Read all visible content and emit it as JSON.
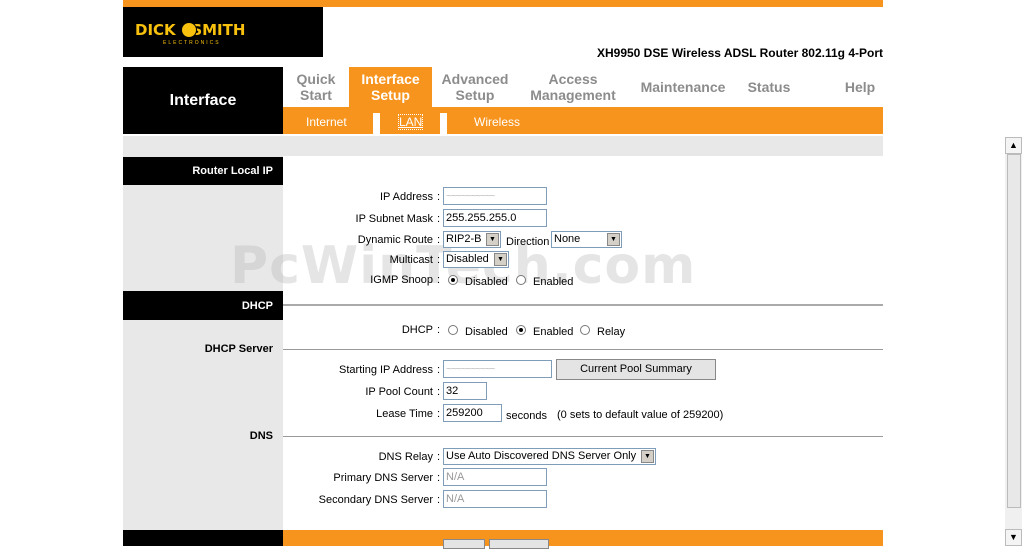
{
  "brand": {
    "logo_text": "DICK   SMITH",
    "logo_sub": "ELECTRONICS"
  },
  "model": "XH9950 DSE Wireless ADSL Router 802.11g 4-Port",
  "colors": {
    "accent": "#f7941d",
    "nav_inactive": "#8c8c8c"
  },
  "page_title": "Interface",
  "nav": [
    {
      "l1": "Quick",
      "l2": "Start"
    },
    {
      "l1": "Interface",
      "l2": "Setup"
    },
    {
      "l1": "Advanced",
      "l2": "Setup"
    },
    {
      "l1": "Access",
      "l2": "Management"
    },
    {
      "l1": "Maintenance",
      "l2": ""
    },
    {
      "l1": "Status",
      "l2": ""
    },
    {
      "l1": "Help",
      "l2": ""
    }
  ],
  "subnav": {
    "internet": "Internet",
    "lan": "LAN",
    "wireless": "Wireless"
  },
  "sections": {
    "router_local_ip": "Router Local IP",
    "dhcp": "DHCP",
    "dhcp_server": "DHCP Server",
    "dns": "DNS"
  },
  "lan": {
    "ip_label": "IP Address",
    "ip_value": "~~~~~~~~~~",
    "mask_label": "IP Subnet Mask",
    "mask_value": "255.255.255.0",
    "route_label": "Dynamic Route",
    "route_value": "RIP2-B",
    "direction_label": "Direction",
    "direction_value": "None",
    "multicast_label": "Multicast",
    "multicast_value": "Disabled",
    "igmp_label": "IGMP Snoop",
    "igmp_disabled": "Disabled",
    "igmp_enabled": "Enabled"
  },
  "dhcp": {
    "label": "DHCP",
    "disabled": "Disabled",
    "enabled": "Enabled",
    "relay": "Relay",
    "start_label": "Starting IP Address",
    "start_value": "~~~~~~~~~~",
    "pool_button": "Current Pool Summary",
    "count_label": "IP Pool Count",
    "count_value": "32",
    "lease_label": "Lease Time",
    "lease_value": "259200",
    "lease_unit": "seconds",
    "lease_note": "(0 sets to default value of 259200)"
  },
  "dns": {
    "relay_label": "DNS Relay",
    "relay_value": "Use Auto Discovered DNS Server Only",
    "primary_label": "Primary DNS Server",
    "primary_value": "N/A",
    "secondary_label": "Secondary DNS Server",
    "secondary_value": "N/A"
  },
  "watermark": "PcWinTech.com",
  "colon": ":"
}
